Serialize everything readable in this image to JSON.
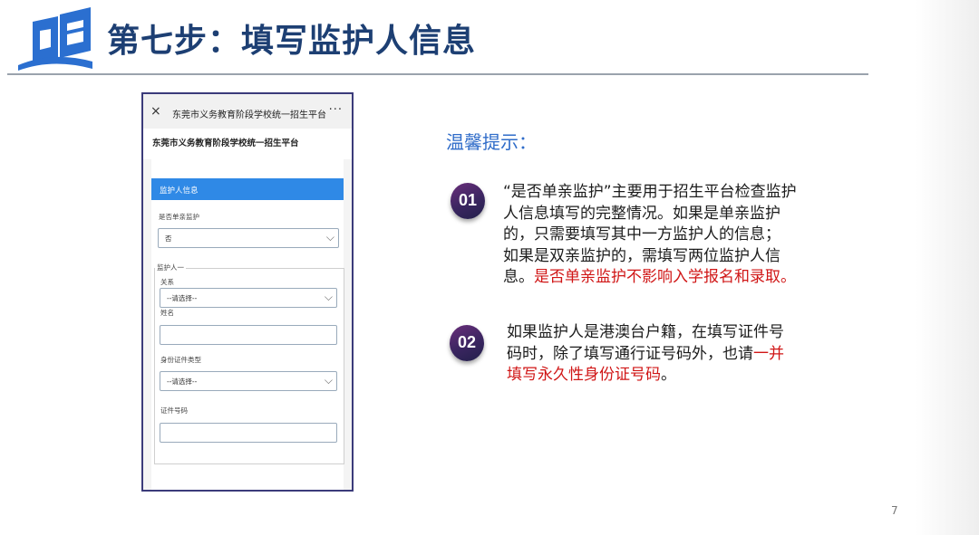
{
  "slide": {
    "title": "第七步：填写监护人信息",
    "tips_title": "温馨提示：",
    "page_number": "7",
    "colors": {
      "title": "#1d3f73",
      "accent_blue": "#2f6cc9",
      "highlight_red": "#d01616",
      "badge_purple": "#3a2560",
      "form_header_blue": "#2f89e6"
    }
  },
  "phone": {
    "close_icon": "×",
    "bar_title": "东莞市义务教育阶段学校统一招生平台",
    "more_icon": "···",
    "subtitle": "东莞市义务教育阶段学校统一招生平台",
    "section_header": "监护人信息",
    "single_parent_label": "是否单亲监护",
    "single_parent_value": "否",
    "guardian_group_label": "监护人一",
    "relation_label": "关系",
    "relation_placeholder": "--请选择--",
    "name_label": "姓名",
    "id_type_label": "身份证件类型",
    "id_type_placeholder": "--请选择--",
    "id_number_label": "证件号码"
  },
  "tips": [
    {
      "number": "01",
      "lines": [
        "“是否单亲监护”主要用于招生平台检查监护",
        "人信息填写的完整情况。如果是单亲监护",
        "的，只需要填写其中一方监护人的信息；",
        "如果是双亲监护的，需填写两位监护人信"
      ],
      "last_line_prefix": "息。",
      "last_line_highlight": "是否单亲监护不影响入学报名和录取。"
    },
    {
      "number": "02",
      "lines": [
        "如果监护人是港澳台户籍，在填写证件号"
      ],
      "line2_prefix": "码时，除了填写通行证号码外，也请",
      "line2_highlight": "一并",
      "line3_highlight": "填写永久性身份证号码",
      "line3_suffix": "。"
    }
  ]
}
